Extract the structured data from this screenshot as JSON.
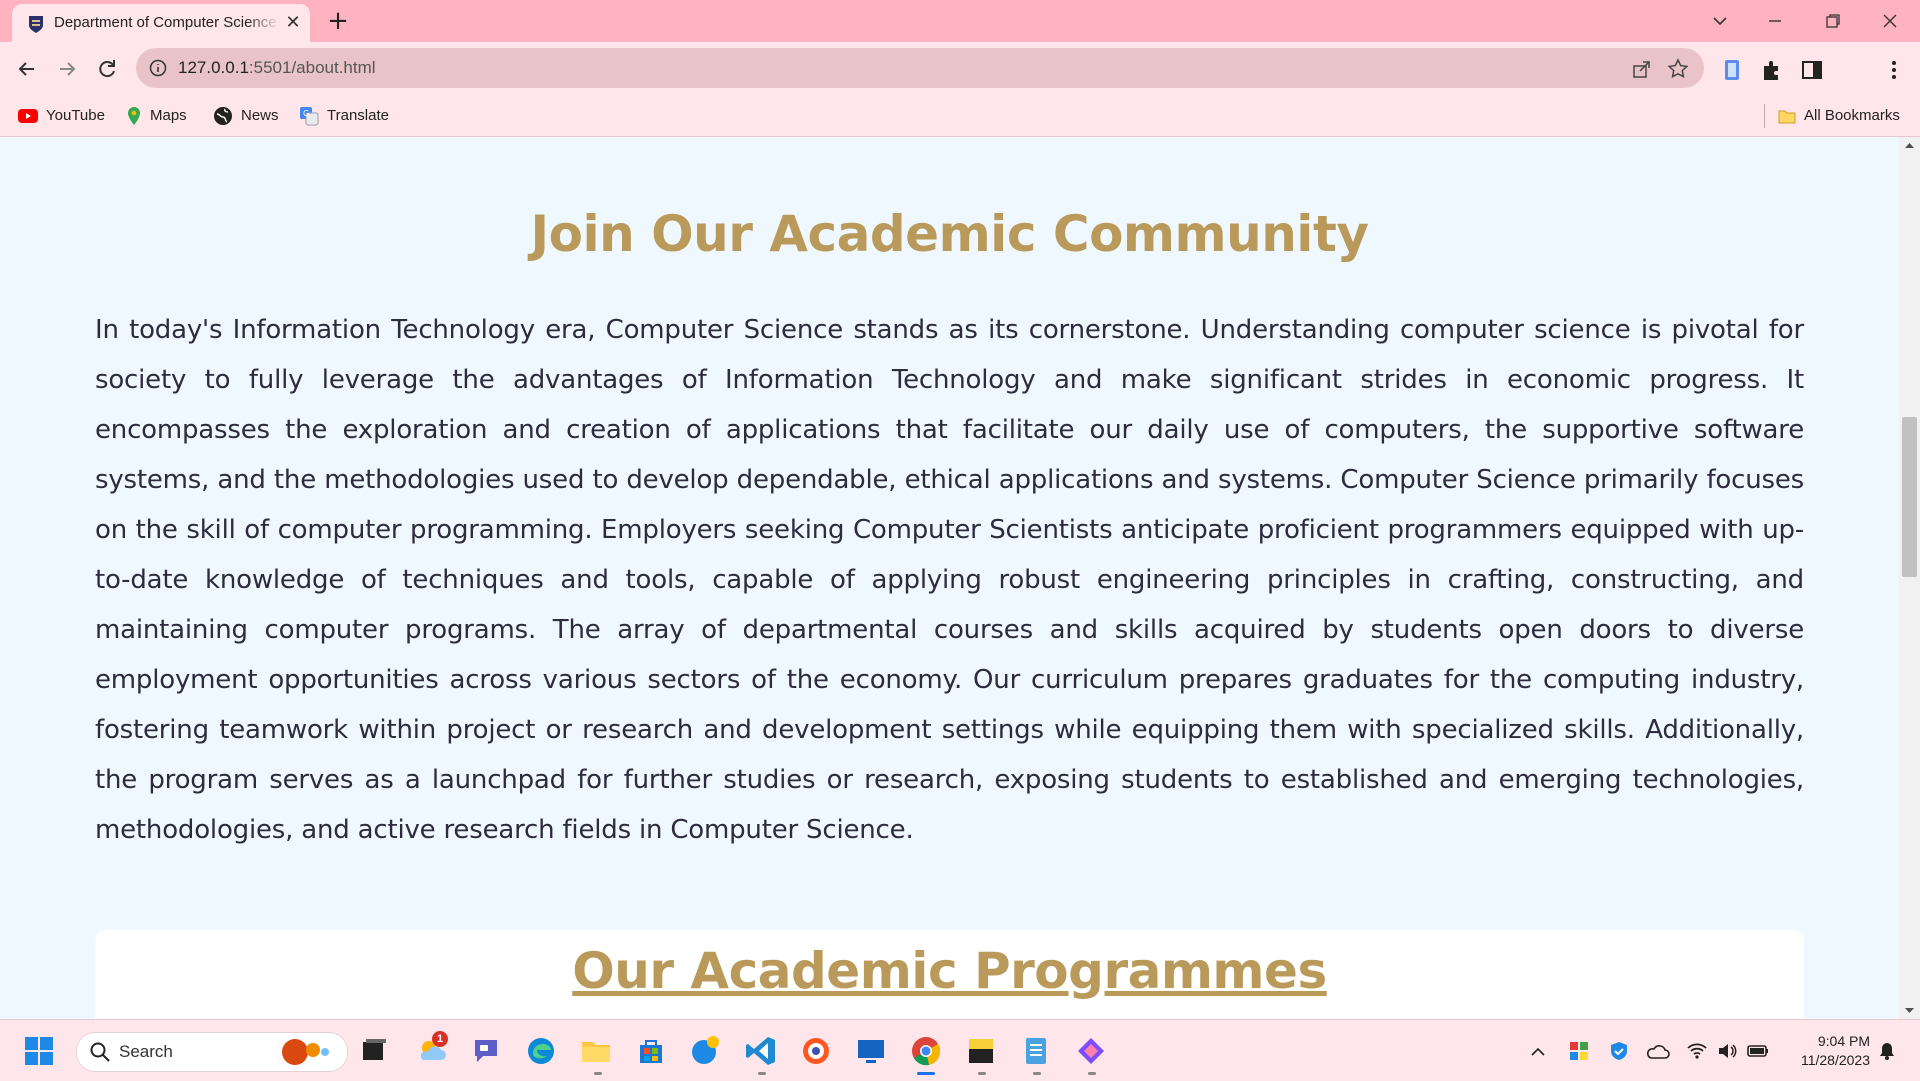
{
  "browser": {
    "tab_title": "Department of Computer Science",
    "url_host": "127.0.0.1",
    "url_rest": ":5501/about.html",
    "bookmarks": [
      "YouTube",
      "Maps",
      "News",
      "Translate"
    ],
    "all_bookmarks": "All Bookmarks"
  },
  "page": {
    "heading": "Join Our Academic Community",
    "paragraph": "In today's Information Technology era, Computer Science stands as its cornerstone. Understanding computer science is pivotal for society to fully leverage the advantages of Information Technology and make significant strides in economic progress. It encompasses the exploration and creation of applications that facilitate our daily use of computers, the supportive software systems, and the methodologies used to develop dependable, ethical applications and systems. Computer Science primarily focuses on the skill of computer programming. Employers seeking Computer Scientists anticipate proficient programmers equipped with up-to-date knowledge of techniques and tools, capable of applying robust engineering principles in crafting, constructing, and maintaining computer programs. The array of departmental courses and skills acquired by students open doors to diverse employment opportunities across various sectors of the economy. Our curriculum prepares graduates for the computing industry, fostering teamwork within project or research and development settings while equipping them with specialized skills. Additionally, the program serves as a launchpad for further studies or research, exposing students to established and emerging technologies, methodologies, and active research fields in Computer Science.",
    "programmes_heading": "Our Academic Programmes"
  },
  "taskbar": {
    "search_placeholder": "Search",
    "notification_count": "1",
    "time": "9:04 PM",
    "date": "11/28/2023"
  },
  "colors": {
    "heading_gold": "#b99a5b",
    "page_bg": "#f0f8ff",
    "chrome_pink": "#ffb3c1"
  }
}
